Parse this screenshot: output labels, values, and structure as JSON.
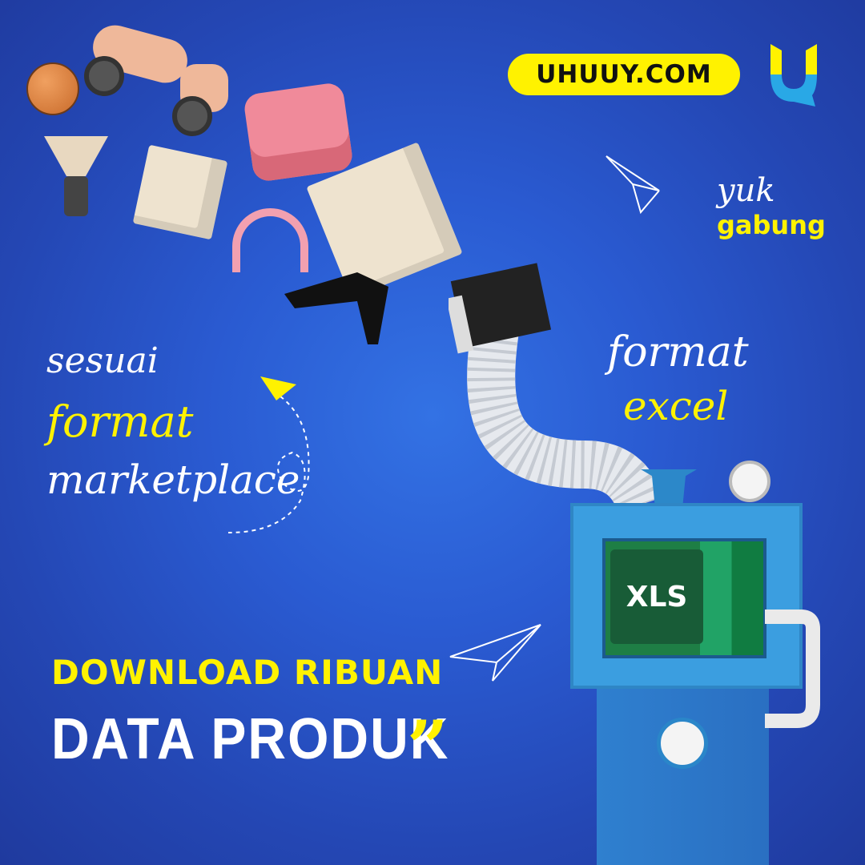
{
  "brand": {
    "site_label": "UHUUY.COM",
    "logo_letter": "U"
  },
  "taglines": {
    "join_line1": "yuk",
    "join_line2": "gabung",
    "format_line1": "format",
    "format_line2": "excel",
    "left_line1": "sesuai",
    "left_line2": "format",
    "left_line3": "marketplace"
  },
  "headline": {
    "line1": "DOWNLOAD RIBUAN",
    "line2": "DATA PRODUK",
    "quote_mark": "”"
  },
  "machine": {
    "screen_label": "XLS"
  },
  "colors": {
    "background": "#2a5bd2",
    "accent_yellow": "#fff200",
    "machine_blue": "#3b9ee0",
    "excel_green": "#1e7e45"
  }
}
